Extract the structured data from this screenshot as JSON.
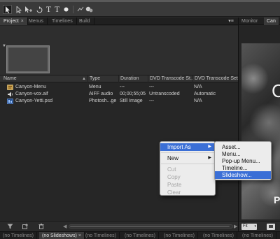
{
  "toolbar": {
    "tools": [
      {
        "name": "selection-tool",
        "icon": "arrow-pointer-icon"
      },
      {
        "name": "direct-select-tool",
        "icon": "arrow-outline-icon"
      },
      {
        "name": "direct-select-plus-tool",
        "icon": "arrow-plus-icon"
      },
      {
        "name": "rotate-tool",
        "icon": "rotate-icon"
      },
      {
        "name": "text-tool",
        "icon": "text-icon",
        "glyph": "T"
      },
      {
        "name": "vertical-text-tool",
        "icon": "vertical-text-icon",
        "glyph": "T"
      },
      {
        "name": "ellipse-tool",
        "icon": "ellipse-icon"
      },
      {
        "name": "hand-tool",
        "icon": "hand-icon"
      },
      {
        "name": "zoom-tool",
        "icon": "zoom-icon"
      }
    ]
  },
  "project_panel": {
    "tabs": [
      {
        "label": "Project",
        "close": "×",
        "active": true
      },
      {
        "label": "Menus",
        "active": false
      },
      {
        "label": "Timelines",
        "active": false
      },
      {
        "label": "Build",
        "active": false
      }
    ],
    "panel_menu_glyph": "▾≡",
    "columns": [
      "Name",
      "Type",
      "Duration",
      "DVD Transcode St...",
      "DVD Transcode Settin"
    ],
    "rows": [
      {
        "name": "Canyon-Menu",
        "type": "Menu",
        "duration": "---",
        "transcode_status": "---",
        "transcode_settings": "N/A",
        "icon": "menu-file-icon"
      },
      {
        "name": "Canyon-vox.aif",
        "type": "AIFF audio",
        "duration": "00;00;55;05",
        "transcode_status": "Untranscoded",
        "transcode_settings": "Automatic",
        "icon": "audio-file-icon"
      },
      {
        "name": "Canyon-Yetti.psd",
        "type": "Photosh...ge",
        "duration": "Still Image",
        "transcode_status": "---",
        "transcode_settings": "N/A",
        "icon": "photoshop-file-icon"
      }
    ]
  },
  "monitor_panel": {
    "tabs": [
      {
        "label": "Monitor",
        "active": false
      },
      {
        "label": "Can",
        "active": true
      }
    ],
    "preview_text_top": "C",
    "preview_text_bottom": "P",
    "zoom_select": "Fit"
  },
  "timeline_tabs": [
    {
      "label": "(no Timelines)",
      "active": false
    },
    {
      "label": "(no Slideshows)",
      "close": "×",
      "active": true
    },
    {
      "label": "(no Timelines)",
      "active": false
    },
    {
      "label": "(no Timelines)",
      "active": false
    },
    {
      "label": "(no Timelines)",
      "active": false
    },
    {
      "label": "(no Timelines)",
      "active": false
    },
    {
      "label": "(no Timelines)",
      "active": false
    }
  ],
  "context_menu": {
    "items": [
      {
        "label": "Import As",
        "submenu": true,
        "highlighted": true,
        "disabled": false
      },
      {
        "label": "New",
        "submenu": true,
        "highlighted": false,
        "disabled": false
      },
      {
        "label": "Cut",
        "disabled": true
      },
      {
        "label": "Copy",
        "disabled": true
      },
      {
        "label": "Paste",
        "disabled": true
      },
      {
        "label": "Clear",
        "disabled": true
      }
    ],
    "submenu_arrow": "▶"
  },
  "import_submenu": {
    "items": [
      {
        "label": "Asset...",
        "highlighted": false
      },
      {
        "label": "Menu...",
        "highlighted": false
      },
      {
        "label": "Pop-up Menu...",
        "highlighted": false
      },
      {
        "label": "Timeline...",
        "highlighted": false
      },
      {
        "label": "Slideshow...",
        "highlighted": true
      }
    ]
  },
  "colors": {
    "highlight": "#3b6fd6",
    "panel_bg": "#262626",
    "menu_bg": "#ececec"
  }
}
